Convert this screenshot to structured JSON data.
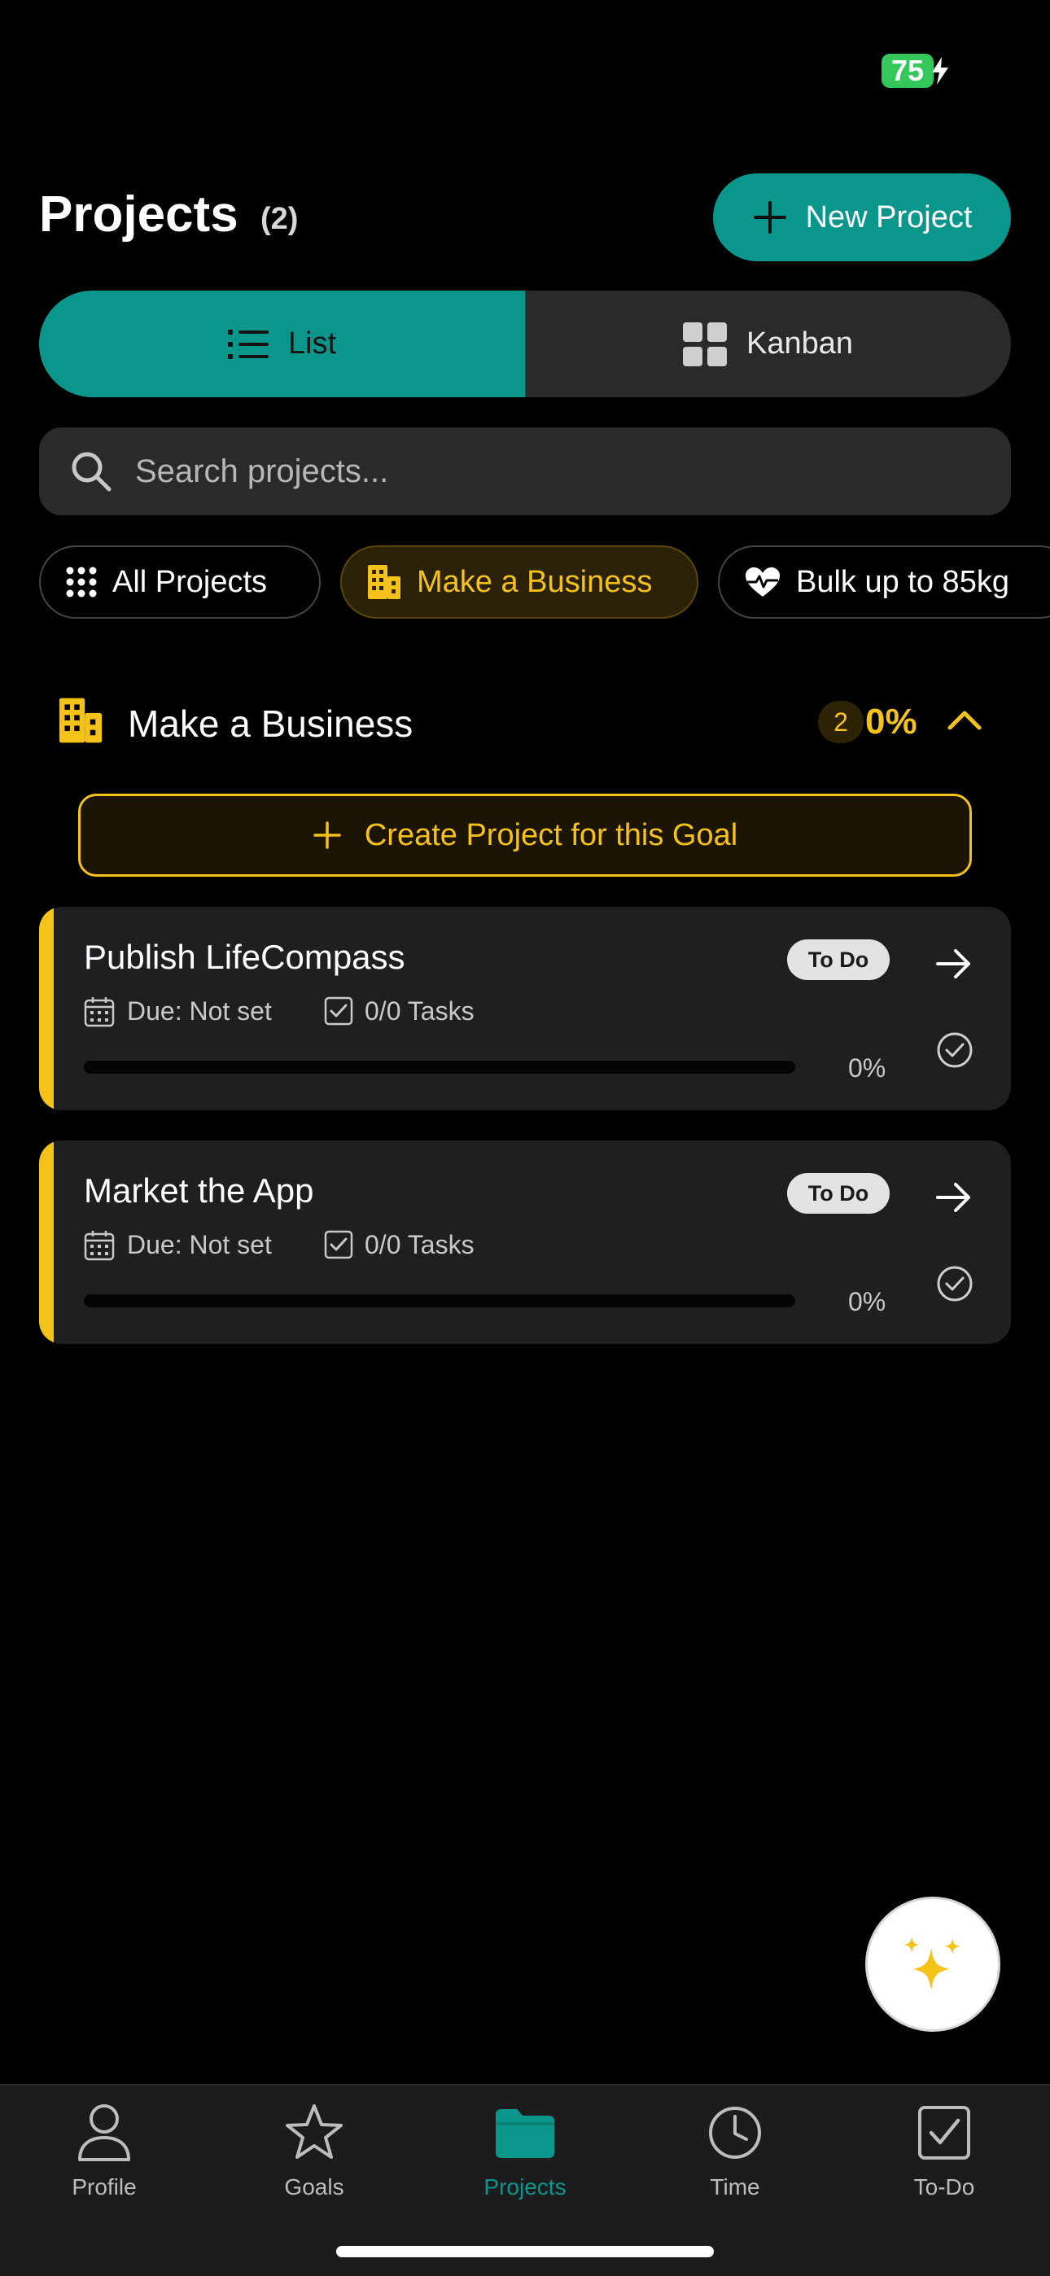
{
  "status_bar": {
    "battery": "75"
  },
  "header": {
    "title": "Projects",
    "count": "(2)",
    "new_project_label": "New Project"
  },
  "view_toggle": {
    "list_label": "List",
    "kanban_label": "Kanban",
    "active": "List"
  },
  "search": {
    "placeholder": "Search projects..."
  },
  "filters": [
    {
      "label": "All Projects",
      "icon": "grid-dots-icon"
    },
    {
      "label": "Make a Business",
      "icon": "building-icon",
      "selected": true
    },
    {
      "label": "Bulk up to 85kg",
      "icon": "heart-pulse-icon"
    }
  ],
  "goal": {
    "title": "Make a Business",
    "count": "2",
    "progress": "0%",
    "create_label": "Create Project for this Goal"
  },
  "projects": [
    {
      "title": "Publish LifeCompass",
      "status": "To Do",
      "due": "Due: Not set",
      "tasks": "0/0 Tasks",
      "progress": "0%",
      "progress_value": 0
    },
    {
      "title": "Market the App",
      "status": "To Do",
      "due": "Due: Not set",
      "tasks": "0/0 Tasks",
      "progress": "0%",
      "progress_value": 0
    }
  ],
  "tabs": [
    {
      "label": "Profile",
      "icon": "person-icon"
    },
    {
      "label": "Goals",
      "icon": "star-icon"
    },
    {
      "label": "Projects",
      "icon": "folder-icon",
      "active": true
    },
    {
      "label": "Time",
      "icon": "clock-icon"
    },
    {
      "label": "To-Do",
      "icon": "checkbox-icon"
    }
  ],
  "colors": {
    "accent": "#0a968a",
    "goal": "#f5c21a",
    "background": "#000000",
    "card": "#1f1f21"
  }
}
